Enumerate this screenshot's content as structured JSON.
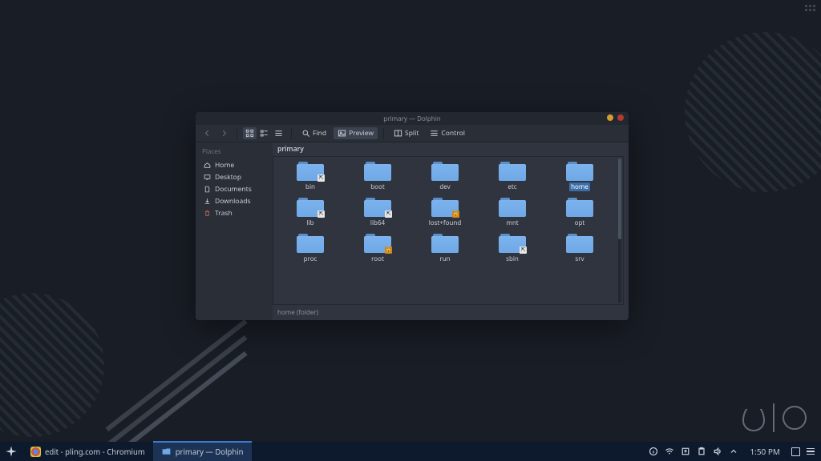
{
  "window": {
    "title": "primary — Dolphin",
    "toolbar": {
      "find": "Find",
      "preview": "Preview",
      "split": "Split",
      "control": "Control"
    },
    "breadcrumb": "primary",
    "sidebar": {
      "section": "Places",
      "items": [
        {
          "label": "Home",
          "icon": "home-icon"
        },
        {
          "label": "Desktop",
          "icon": "desktop-icon"
        },
        {
          "label": "Documents",
          "icon": "documents-icon"
        },
        {
          "label": "Downloads",
          "icon": "downloads-icon"
        },
        {
          "label": "Trash",
          "icon": "trash-icon"
        }
      ]
    },
    "files": [
      {
        "name": "bin",
        "badge": "link"
      },
      {
        "name": "boot",
        "badge": null
      },
      {
        "name": "dev",
        "badge": null
      },
      {
        "name": "etc",
        "badge": null
      },
      {
        "name": "home",
        "badge": null,
        "selected": true
      },
      {
        "name": "lib",
        "badge": "link"
      },
      {
        "name": "lib64",
        "badge": "link"
      },
      {
        "name": "lost+found",
        "badge": "lock"
      },
      {
        "name": "mnt",
        "badge": null
      },
      {
        "name": "opt",
        "badge": null
      },
      {
        "name": "proc",
        "badge": null
      },
      {
        "name": "root",
        "badge": "lock"
      },
      {
        "name": "run",
        "badge": null
      },
      {
        "name": "sbin",
        "badge": "link"
      },
      {
        "name": "srv",
        "badge": null
      }
    ],
    "status": "home (folder)"
  },
  "taskbar": {
    "tasks": [
      {
        "app": "Chromium",
        "title": "edit - pling.com - Chromium",
        "icon": "chromium-icon",
        "active": false
      },
      {
        "app": "Dolphin",
        "title": "primary — Dolphin",
        "icon": "dolphin-icon",
        "active": true
      }
    ],
    "clock": "1:50 PM"
  }
}
